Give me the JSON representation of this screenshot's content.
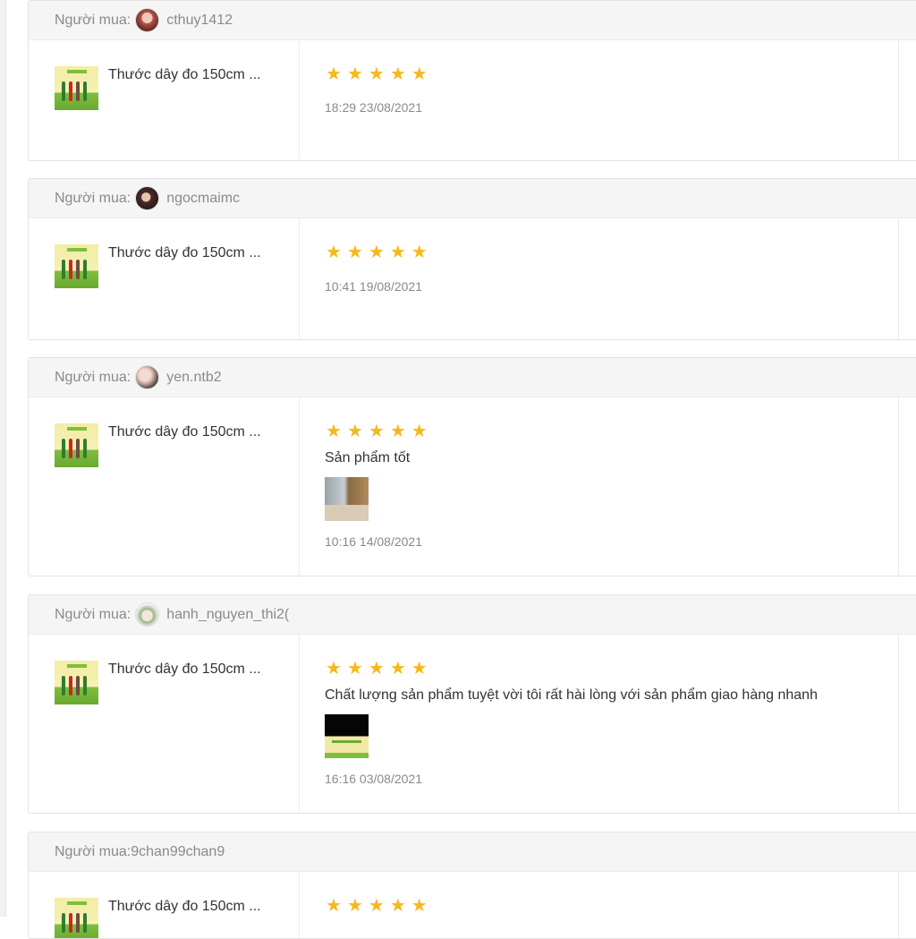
{
  "buyer_label": "Người mua:",
  "reviews": [
    {
      "username": "cthuy1412",
      "product": "Thước dây đo 150cm ...",
      "stars": 5,
      "comment": "",
      "has_photo": false,
      "time": "18:29 23/08/2021"
    },
    {
      "username": "ngocmaimc",
      "product": "Thước dây đo 150cm ...",
      "stars": 5,
      "comment": "",
      "has_photo": false,
      "time": "10:41 19/08/2021"
    },
    {
      "username": "yen.ntb2",
      "product": "Thước dây đo 150cm ...",
      "stars": 5,
      "comment": "Sản phẩm tốt",
      "has_photo": true,
      "time": "10:16 14/08/2021"
    },
    {
      "username": "hanh_nguyen_thi2(",
      "product": "Thước dây đo 150cm ...",
      "stars": 5,
      "comment": "Chất lượng sản phẩm tuyệt vời tôi rất hài lòng với sản phẩm giao hàng nhanh",
      "has_photo": true,
      "time": "16:16 03/08/2021"
    },
    {
      "buyer_inline": "Người mua:9chan99chan9",
      "product": "Thước dây đo 150cm ...",
      "stars": 5
    }
  ],
  "colors": {
    "star": "#f6b81c",
    "header_bg": "#f5f5f5",
    "text": "#333333",
    "muted": "#8a8a8a"
  }
}
